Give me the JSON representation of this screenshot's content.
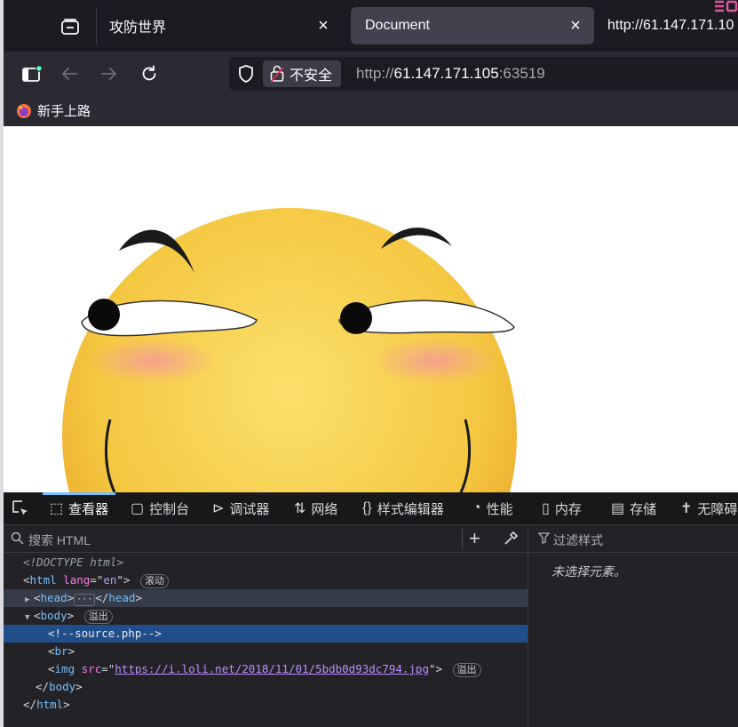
{
  "tabs": [
    {
      "label": "攻防世界",
      "active": false
    },
    {
      "label": "Document",
      "active": true
    },
    {
      "label": "http://61.147.171.10",
      "active": false
    }
  ],
  "nav": {
    "security_label": "不安全",
    "url_scheme": "http://",
    "url_host": "61.147.171.105",
    "url_port": ":63519"
  },
  "bookmarks": [
    {
      "label": "新手上路"
    }
  ],
  "devtools": {
    "tabs": [
      {
        "label": "查看器",
        "icon": "inspector-icon",
        "selected": true
      },
      {
        "label": "控制台",
        "icon": "console-icon"
      },
      {
        "label": "调试器",
        "icon": "debugger-icon"
      },
      {
        "label": "网络",
        "icon": "network-icon"
      },
      {
        "label": "样式编辑器",
        "icon": "style-editor-icon"
      },
      {
        "label": "性能",
        "icon": "performance-icon"
      },
      {
        "label": "内存",
        "icon": "memory-icon"
      },
      {
        "label": "存储",
        "icon": "storage-icon"
      },
      {
        "label": "无障碍",
        "icon": "accessibility-icon"
      }
    ],
    "search_placeholder": "搜索 HTML",
    "filter_placeholder": "过滤样式",
    "no_selection": "未选择元素。",
    "markup": {
      "doctype": "<!DOCTYPE html>",
      "html_tag": "html",
      "html_lang_attr": "lang",
      "html_lang_val": "en",
      "badge_scroll": "滚动",
      "head_tag": "head",
      "body_tag": "body",
      "badge_overflow": "溢出",
      "comment": "<!--source.php-->",
      "br_tag": "br",
      "img_tag": "img",
      "img_src_attr": "src",
      "img_src_val": "https://i.loli.net/2018/11/01/5bdb0d93dc794.jpg"
    }
  },
  "colors": {
    "accent": "#75bfff",
    "selection": "#204e8a",
    "attr_name": "#fb7be6",
    "emoji_face": "#f5c842",
    "blush": "#f4a0a0"
  }
}
